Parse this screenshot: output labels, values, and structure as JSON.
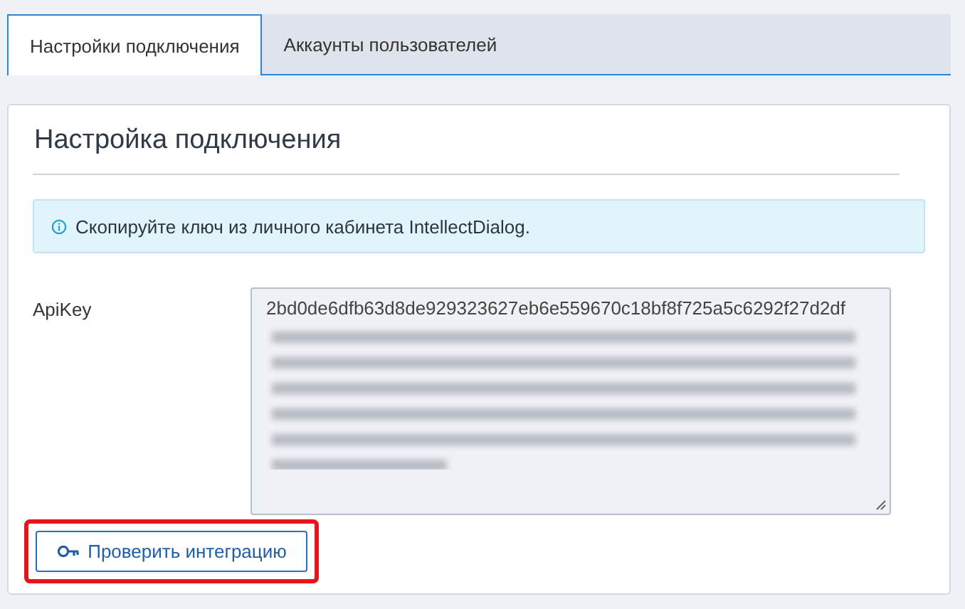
{
  "tabs": [
    {
      "label": "Настройки подключения",
      "selected": true
    },
    {
      "label": "Аккаунты пользователей",
      "selected": false
    }
  ],
  "panel": {
    "title": "Настройка подключения",
    "info": "Скопируйте ключ из личного кабинета IntellectDialog.",
    "api_key": {
      "label": "ApiKey",
      "value": "2bd0de6dfb63d8de929323627eb6e559670c18bf8f725a5c6292f27d2df"
    },
    "button": {
      "label": "Проверить интеграцию",
      "highlighted": true
    }
  }
}
